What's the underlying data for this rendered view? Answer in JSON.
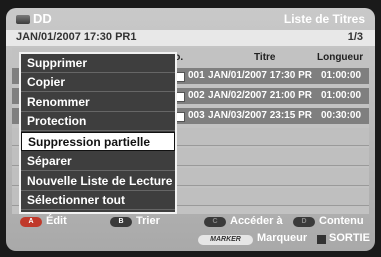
{
  "header": {
    "device": "DD",
    "title": "Liste de Titres",
    "datetime": "JAN/01/2007 17:30 PR1",
    "page": "1/3"
  },
  "table": {
    "columns": [
      "No.",
      "Titre",
      "Longueur"
    ],
    "rows": [
      {
        "no": "001",
        "title": "JAN/01/2007 17:30 PR",
        "length": "01:00:00"
      },
      {
        "no": "002",
        "title": "JAN/02/2007 21:00 PR",
        "length": "01:00:00"
      },
      {
        "no": "003",
        "title": "JAN/03/2007 23:15 PR",
        "length": "00:30:00"
      }
    ]
  },
  "menu": {
    "items": [
      "Supprimer",
      "Copier",
      "Renommer",
      "Protection",
      "Suppression partielle",
      "Séparer",
      "Nouvelle Liste de Lecture",
      "Sélectionner tout"
    ],
    "selected_index": 4
  },
  "footer": {
    "a_key": "A",
    "a_label": "Édit",
    "b_key": "B",
    "b_label": "Trier",
    "c_key": "C",
    "c_label": "Accéder à",
    "d_key": "D",
    "d_label": "Contenu",
    "marker_key": "MARKER",
    "marker_label": "Marqueur",
    "exit_label": "SORTIE"
  },
  "colors": {
    "key_a": "#c0392b",
    "key_b": "#3a3a3a",
    "key_c": "#3a3a3a",
    "key_d": "#3a3a3a",
    "menu_bg": "#3e3e3e",
    "menu_selected_bg": "#ffffff"
  }
}
